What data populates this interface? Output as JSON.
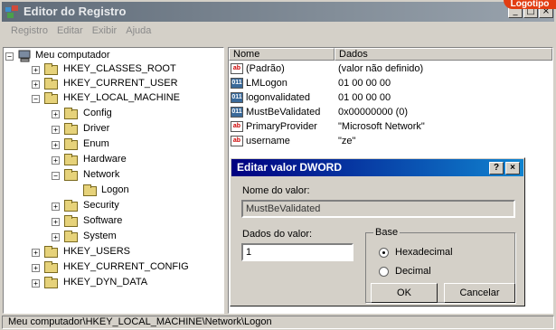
{
  "window": {
    "title": "Editor do Registro",
    "badge": "Logotipo",
    "controls": {
      "minimize": "_",
      "maximize": "□",
      "close": "×"
    }
  },
  "menubar": [
    "Registro",
    "Editar",
    "Exibir",
    "Ajuda"
  ],
  "tree": {
    "root": "Meu computador",
    "nodes": [
      "HKEY_CLASSES_ROOT",
      "HKEY_CURRENT_USER",
      "HKEY_LOCAL_MACHINE",
      "Config",
      "Driver",
      "Enum",
      "Hardware",
      "Network",
      "Logon",
      "Security",
      "Software",
      "System",
      "HKEY_USERS",
      "HKEY_CURRENT_CONFIG",
      "HKEY_DYN_DATA"
    ]
  },
  "list": {
    "columns": {
      "name": "Nome",
      "data": "Dados"
    },
    "rows": [
      {
        "icon": "ab",
        "name": "(Padrão)",
        "data": "(valor não definido)"
      },
      {
        "icon": "bin",
        "name": "LMLogon",
        "data": "01 00 00 00"
      },
      {
        "icon": "bin",
        "name": "logonvalidated",
        "data": "01 00 00 00"
      },
      {
        "icon": "bin",
        "name": "MustBeValidated",
        "data": "0x00000000 (0)"
      },
      {
        "icon": "ab",
        "name": "PrimaryProvider",
        "data": "\"Microsoft Network\""
      },
      {
        "icon": "ab",
        "name": "username",
        "data": "\"ze\""
      }
    ]
  },
  "dialog": {
    "title": "Editar valor DWORD",
    "help": "?",
    "close": "×",
    "name_label": "Nome do valor:",
    "name_value": "MustBeValidated",
    "data_label": "Dados do valor:",
    "data_value": "1",
    "base_label": "Base",
    "hex_label": "Hexadecimal",
    "dec_label": "Decimal",
    "selected_base": "Hexadecimal",
    "ok": "OK",
    "cancel": "Cancelar"
  },
  "status": "Meu computador\\HKEY_LOCAL_MACHINE\\Network\\Logon"
}
